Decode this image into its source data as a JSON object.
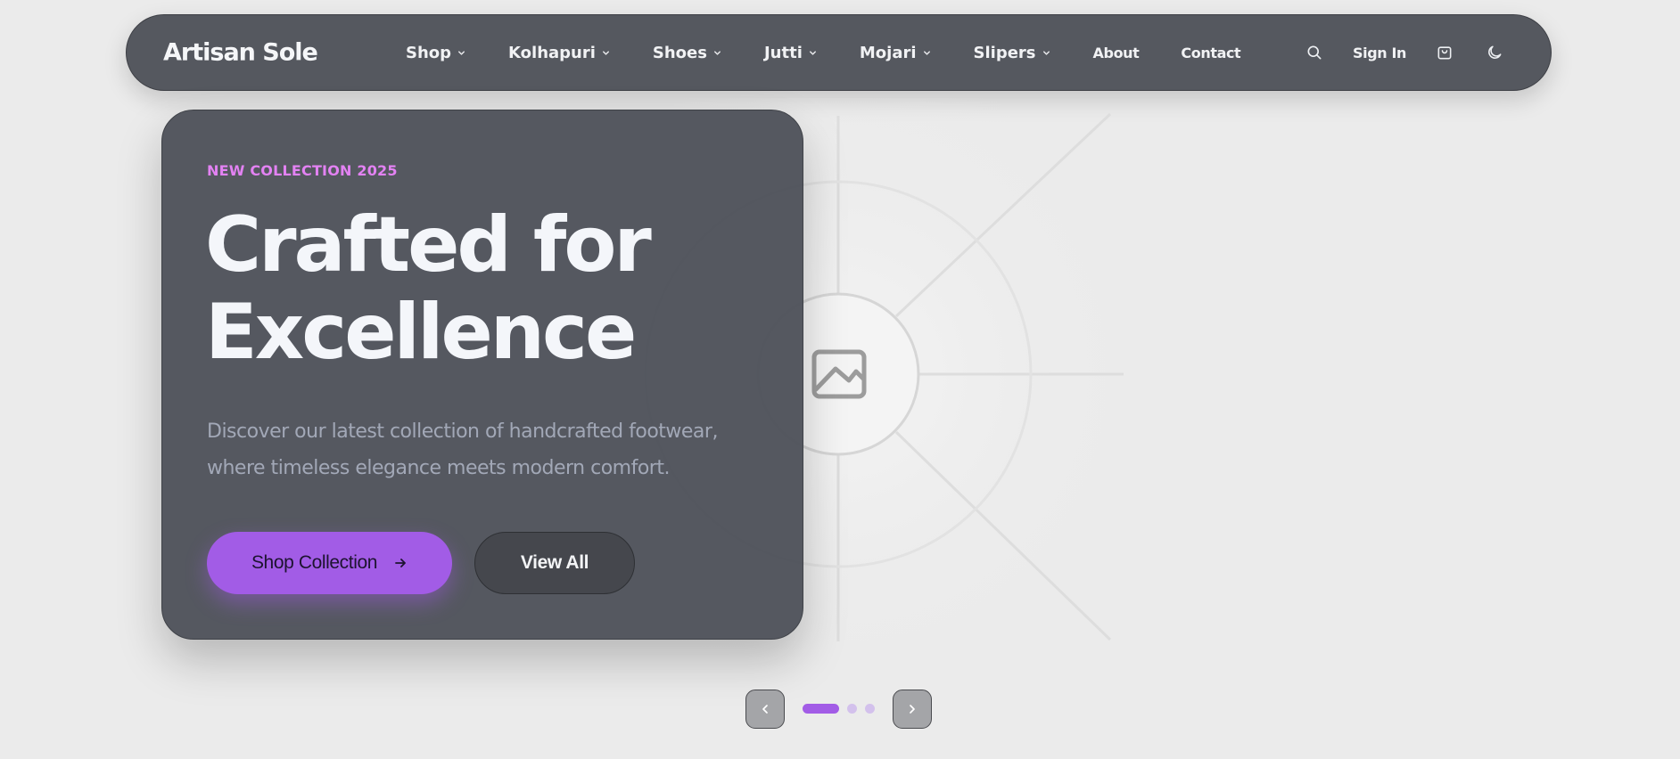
{
  "brand": {
    "name": "Artisan Sole"
  },
  "nav": {
    "items": [
      {
        "label": "Shop",
        "has_dropdown": true
      },
      {
        "label": "Kolhapuri",
        "has_dropdown": true
      },
      {
        "label": "Shoes",
        "has_dropdown": true
      },
      {
        "label": "Jutti",
        "has_dropdown": true
      },
      {
        "label": "Mojari",
        "has_dropdown": true
      },
      {
        "label": "Slipers",
        "has_dropdown": true
      },
      {
        "label": "About",
        "has_dropdown": false
      },
      {
        "label": "Contact",
        "has_dropdown": false
      }
    ],
    "sign_in_label": "Sign In",
    "icons": [
      "search-icon",
      "shopping-bag-icon",
      "moon-icon",
      "chevron-down-icon"
    ]
  },
  "hero": {
    "eyebrow": "NEW COLLECTION 2025",
    "headline_lines": [
      "Crafted for",
      "Excellence"
    ],
    "description_lines": [
      "Discover our latest collection of handcrafted footwear,",
      "where timeless elegance meets modern comfort."
    ],
    "primary_cta": "Shop Collection",
    "secondary_cta": "View All",
    "image_icon": "image-placeholder-icon"
  },
  "carousel": {
    "slide_count": 3,
    "active_index": 0,
    "prev_icon": "chevron-left-icon",
    "next_icon": "chevron-right-icon"
  },
  "colors": {
    "accent": "#a25ce6",
    "eyebrow": "#e382f3",
    "card_bg": "#50535b",
    "nav_bg": "#55585f",
    "page_bg": "#ebebeb"
  }
}
